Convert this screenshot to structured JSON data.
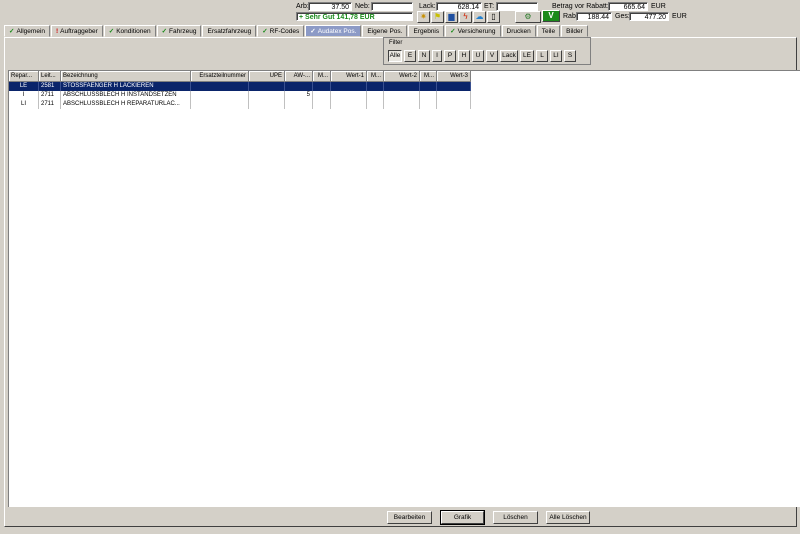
{
  "top": {
    "arb_label": "Arb:",
    "arb_value": "37.50",
    "neb_label": "Neb:",
    "neb_value": "",
    "rating_text": "+ Sehr Gut 141,78 EUR",
    "lack_label": "Lack:",
    "lack_value": "628.14",
    "et_label": "ET:",
    "et_value": "",
    "betrag_label": "Betrag vor Rabatt:",
    "betrag_value": "665.64",
    "betrag_unit": "EUR",
    "rab_label": "Rab:",
    "rab_value": "188.44",
    "ges_label": "Ges:",
    "ges_value": "477.20",
    "ges_unit": "EUR",
    "v_button": "V"
  },
  "tabs": [
    {
      "label": "Allgemein",
      "mark": "check"
    },
    {
      "label": "Auftraggeber",
      "mark": "exclaim"
    },
    {
      "label": "Konditionen",
      "mark": "check"
    },
    {
      "label": "Fahrzeug",
      "mark": "check"
    },
    {
      "label": "Ersatzfahrzeug",
      "mark": ""
    },
    {
      "label": "RF-Codes",
      "mark": "check"
    },
    {
      "label": "Audatex Pos.",
      "mark": "check",
      "active": true
    },
    {
      "label": "Eigene Pos.",
      "mark": ""
    },
    {
      "label": "Ergebnis",
      "mark": ""
    },
    {
      "label": "Versicherung",
      "mark": "check"
    },
    {
      "label": "Drucken",
      "mark": ""
    },
    {
      "label": "Teile",
      "mark": ""
    },
    {
      "label": "Bilder",
      "mark": ""
    }
  ],
  "filter": {
    "title": "Filter",
    "buttons": [
      "Alle",
      "E",
      "N",
      "I",
      "P",
      "H",
      "U",
      "V",
      "Lack",
      "LE",
      "L",
      "LI",
      "S"
    ],
    "selected": "Alle"
  },
  "grid": {
    "columns": [
      "Repar...",
      "Leit...",
      "Bezeichnung",
      "Ersatzteilnummer",
      "UPE",
      "AW-...",
      "M...",
      "Wert-1",
      "M...",
      "Wert-2",
      "M...",
      "Wert-3"
    ],
    "rows": [
      {
        "repar": "LE",
        "leit": "2581",
        "bez": "STOSSFAENGER H LACKIEREN",
        "nr": "",
        "upe": "",
        "aw": "",
        "selected": true
      },
      {
        "repar": "I",
        "leit": "2711",
        "bez": "ABSCHLUSSBLECH H INSTANDSETZEN",
        "nr": "",
        "upe": "",
        "aw": "5",
        "selected": false
      },
      {
        "repar": "LI",
        "leit": "2711",
        "bez": "ABSCHLUSSBLECH H REPARATURLAC...",
        "nr": "",
        "upe": "",
        "aw": "",
        "selected": false
      }
    ]
  },
  "buttons": {
    "bearbeiten": "Bearbeiten",
    "grafik": "Grafik",
    "loeschen": "Löschen",
    "alle_loeschen": "Alle Löschen"
  },
  "icons": [
    "star-icon",
    "flag-icon",
    "car-icon",
    "flash-icon",
    "cloud-icon",
    "document-icon",
    "tools-icon"
  ],
  "colors": {
    "accent_tab": "#8c9ac6",
    "selection": "#0a246a",
    "rating_green": "#1a8a1a"
  }
}
